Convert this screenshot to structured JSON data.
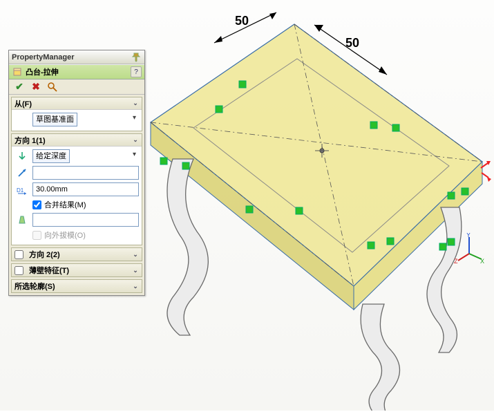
{
  "propertymanager": {
    "title": "PropertyManager",
    "feature_name": "凸台-拉伸",
    "help_label": "?",
    "from": {
      "title": "从(F)",
      "mode": "草图基准面"
    },
    "dir1": {
      "title": "方向 1(1)",
      "end_condition": "给定深度",
      "depth": "30.00mm",
      "merge": {
        "checked": true,
        "label": "合并结果(M)"
      },
      "draft_on": {
        "checked": false,
        "label": "向外拔模(O)"
      }
    },
    "dir2": {
      "title": "方向 2(2)",
      "enabled": false
    },
    "thin": {
      "title": "薄壁特征(T)",
      "enabled": false
    },
    "contours": {
      "title": "所选轮廓(S)"
    }
  },
  "dimensions": {
    "d1": "50",
    "d2": "50"
  },
  "triad": {
    "x": "X",
    "y": "Y",
    "z": "Z"
  }
}
